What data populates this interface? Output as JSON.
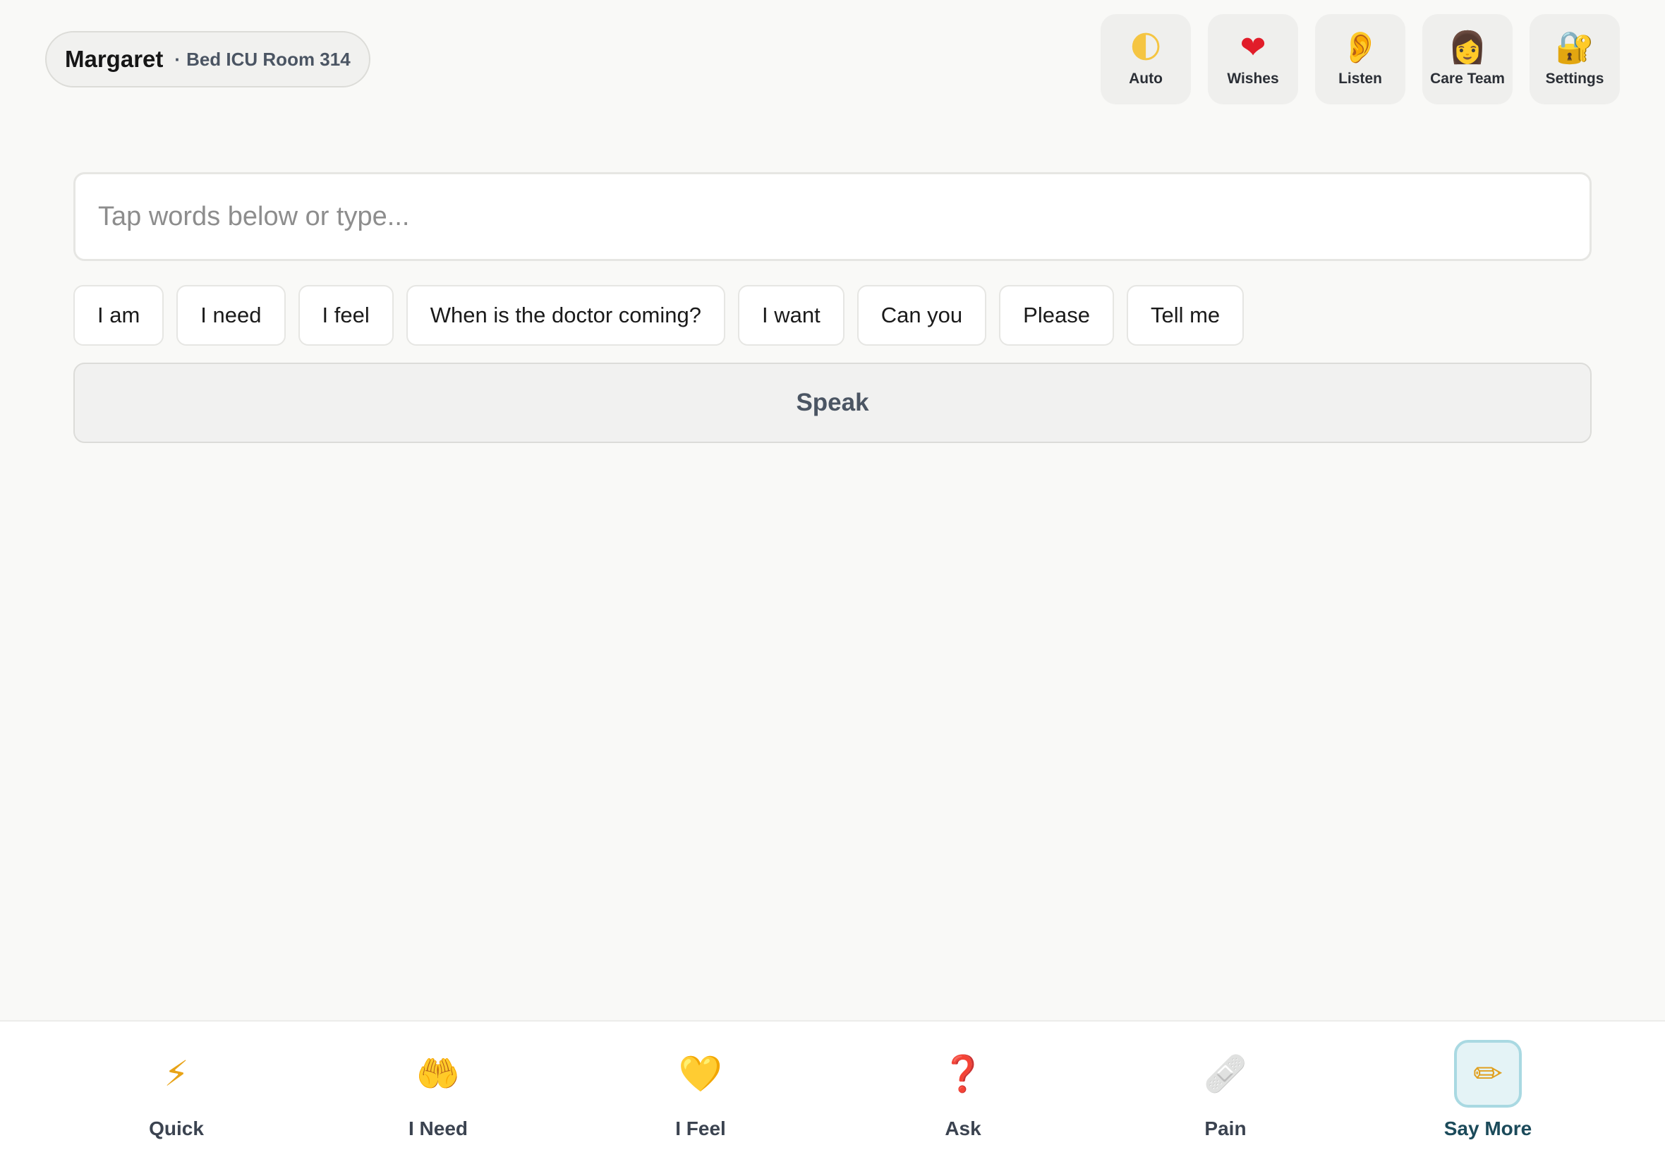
{
  "header": {
    "patient_name": "Margaret",
    "separator": "·",
    "room": "Bed ICU Room 314"
  },
  "top_actions": [
    {
      "label": "Auto",
      "icon": "moon-icon",
      "glyph": "🌓",
      "color": "#f5c542"
    },
    {
      "label": "Wishes",
      "icon": "heart-icon",
      "glyph": "❤",
      "color": "#e11d2a"
    },
    {
      "label": "Listen",
      "icon": "ear-icon",
      "glyph": "👂",
      "color": "#f0b35a"
    },
    {
      "label": "Care Team",
      "icon": "nurse-icon",
      "glyph": "👩",
      "color": "#e7a84a"
    },
    {
      "label": "Settings",
      "icon": "lock-icon",
      "glyph": "🔐",
      "color": "#c99a2e"
    }
  ],
  "composer": {
    "placeholder": "Tap words below or type...",
    "value": ""
  },
  "phrases": [
    "I am",
    "I need",
    "I feel",
    "When is the doctor coming?",
    "I want",
    "Can you",
    "Please",
    "Tell me"
  ],
  "speak_label": "Speak",
  "bottom_nav": [
    {
      "label": "Quick",
      "icon": "lightning-icon",
      "glyph": "⚡",
      "color": "#e8a317",
      "active": false
    },
    {
      "label": "I Need",
      "icon": "open-hands-icon",
      "glyph": "🤲",
      "color": "#f0b830",
      "active": false
    },
    {
      "label": "I Feel",
      "icon": "yellow-heart-icon",
      "glyph": "💛",
      "color": "#f4c430",
      "active": false
    },
    {
      "label": "Ask",
      "icon": "question-mark-icon",
      "glyph": "❓",
      "color": "#d11a1a",
      "active": false
    },
    {
      "label": "Pain",
      "icon": "bandage-icon",
      "glyph": "🩹",
      "color": "#b8b8b8",
      "active": false
    },
    {
      "label": "Say More",
      "icon": "pencil-icon",
      "glyph": "✏",
      "color": "#e0a020",
      "active": true
    }
  ]
}
